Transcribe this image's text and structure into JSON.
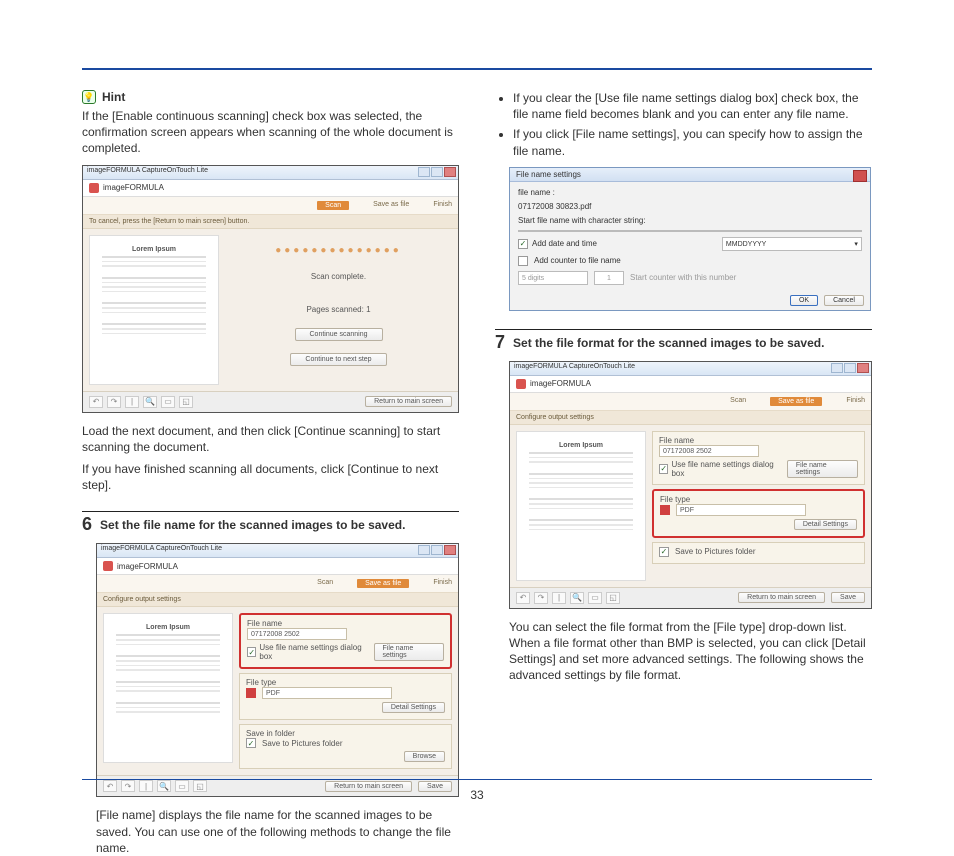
{
  "page_number": "33",
  "hint": {
    "label": "Hint",
    "text": "If the [Enable continuous scanning] check box was selected, the confirmation screen appears when scanning of the whole document is completed."
  },
  "shot_common": {
    "titlebar": "imageFORMULA CaptureOnTouch Lite",
    "brand": "imageFORMULA",
    "crumb_scan": "Scan",
    "crumb_save": "Save as file",
    "crumb_finish": "Finish",
    "preview_title": "Lorem Ipsum",
    "return_btn": "Return to main screen"
  },
  "shot1": {
    "subhead": "To cancel, press the [Return to main screen] button.",
    "scan_complete": "Scan complete.",
    "pages_scanned": "Pages scanned: 1",
    "continue_scanning": "Continue scanning",
    "continue_next": "Continue to next step"
  },
  "after_shot1": {
    "line1": "Load the next document, and then click [Continue scanning] to start scanning the document.",
    "line2": "If you have finished scanning all documents, click [Continue to next step]."
  },
  "step6": {
    "num": "6",
    "title": "Set the file name for the scanned images to be saved."
  },
  "shot2": {
    "subhead": "Configure output settings",
    "file_name_label": "File name",
    "file_name_value": "07172008 2502",
    "use_dialog": "Use file name settings dialog box",
    "file_name_settings_btn": "File name settings",
    "file_type_label": "File type",
    "file_type_value": "PDF",
    "detail_settings_btn": "Detail Settings",
    "save_in_folder": "Save in folder",
    "save_to": "Save to Pictures folder",
    "browse": "Browse",
    "save_btn": "Save"
  },
  "after_shot2": "[File name] displays the file name for the scanned images to be saved. You can use one of the following methods to change the file name.",
  "right_bullets": {
    "b1": "If you clear the [Use file name settings dialog box] check box, the file name field becomes blank and you can enter any file name.",
    "b2": "If you click [File name settings], you can specify how to assign the file name."
  },
  "dialog": {
    "title": "File name settings",
    "filename_label": "file name :",
    "filename_value": "07172008 30823.pdf",
    "start_label": "Start file name with character string:",
    "add_date": "Add date and time",
    "date_format": "MMDDYYYY",
    "add_counter": "Add counter to file name",
    "digits": "5 digits",
    "start_counter_label": "Start counter with this number",
    "start_counter_value": "1",
    "ok": "OK",
    "cancel": "Cancel"
  },
  "step7": {
    "num": "7",
    "title": "Set the file format for the scanned images to be saved."
  },
  "after_step7": "You can select the file format from the [File type] drop-down list. When a file format other than BMP is selected, you can click [Detail Settings] and set more advanced settings. The following shows the advanced settings by file format."
}
